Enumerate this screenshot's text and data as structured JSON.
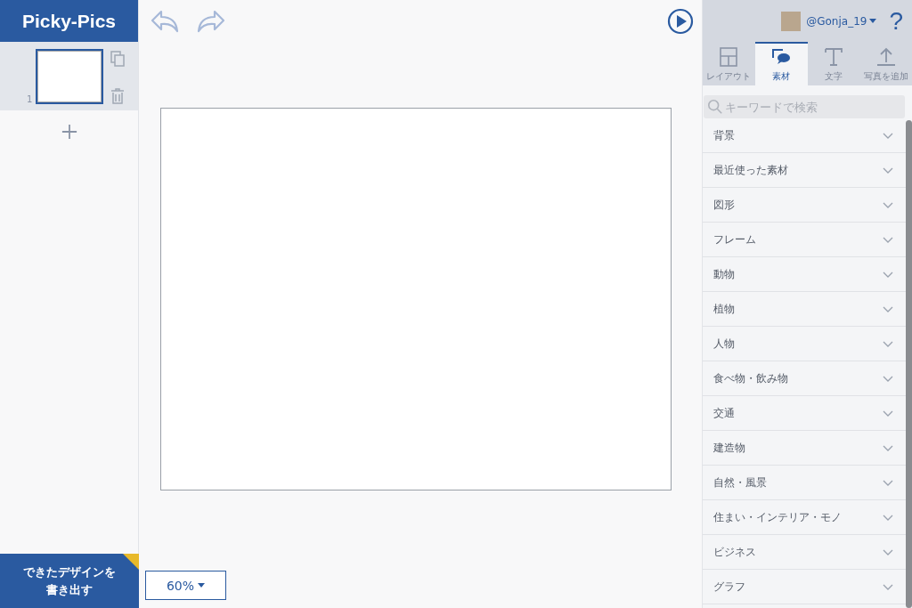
{
  "app": {
    "logo": "Picky-Pics"
  },
  "pages": [
    {
      "number": "1",
      "selected": true
    }
  ],
  "export_button": {
    "label": "できたデザインを書き出す"
  },
  "zoom": {
    "value": "60%"
  },
  "user": {
    "name": "@Gonja_19"
  },
  "help": {
    "label": "?"
  },
  "tabs": [
    {
      "label": "レイアウト",
      "kind": "layout",
      "selected": false
    },
    {
      "label": "素材",
      "kind": "material",
      "selected": true
    },
    {
      "label": "文字",
      "kind": "text",
      "selected": false
    },
    {
      "label": "写真を追加",
      "kind": "upload",
      "selected": false
    }
  ],
  "search": {
    "placeholder": "キーワードで検索"
  },
  "categories": [
    {
      "label": "背景",
      "expanded": false
    },
    {
      "label": "最近使った素材",
      "expanded": false
    },
    {
      "label": "図形",
      "expanded": false
    },
    {
      "label": "フレーム",
      "expanded": false
    },
    {
      "label": "動物",
      "expanded": false
    },
    {
      "label": "植物",
      "expanded": false
    },
    {
      "label": "人物",
      "expanded": false
    },
    {
      "label": "食べ物・飲み物",
      "expanded": false
    },
    {
      "label": "交通",
      "expanded": false
    },
    {
      "label": "建造物",
      "expanded": false
    },
    {
      "label": "自然・風景",
      "expanded": false
    },
    {
      "label": "住まい・インテリア・モノ",
      "expanded": false
    },
    {
      "label": "ビジネス",
      "expanded": false
    },
    {
      "label": "グラフ",
      "expanded": false
    }
  ]
}
